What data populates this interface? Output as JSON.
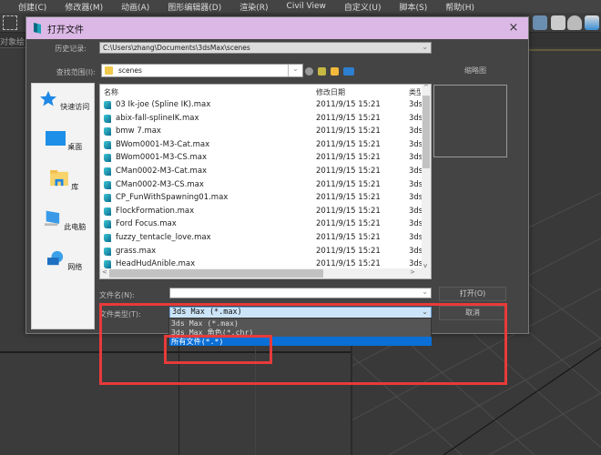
{
  "app": {
    "menu": [
      "创建(C)",
      "修改器(M)",
      "动画(A)",
      "图形编辑器(D)",
      "渲染(R)",
      "Civil View",
      "自定义(U)",
      "脚本(S)",
      "帮助(H)"
    ],
    "subbar_label": "对象绘"
  },
  "dialog": {
    "title": "打开文件",
    "close_icon": "×",
    "history_label": "历史记录:",
    "history_value": "C:\\Users\\zhang\\Documents\\3dsMax\\scenes",
    "lookin_label": "查找范围(I):",
    "lookin_value": "scenes",
    "preview_label": "缩略图",
    "places": [
      {
        "label": "快速访问",
        "icon": "star-icon"
      },
      {
        "label": "桌面",
        "icon": "desktop-icon"
      },
      {
        "label": "库",
        "icon": "library-icon"
      },
      {
        "label": "此电脑",
        "icon": "computer-icon"
      },
      {
        "label": "网络",
        "icon": "network-icon"
      }
    ],
    "columns": {
      "name": "名称",
      "date": "修改日期",
      "type": "类型"
    },
    "files": [
      {
        "name": "03 Ik-joe (Spline IK).max",
        "date": "2011/9/15 15:21",
        "type": "3ds"
      },
      {
        "name": "abix-fall-splineIK.max",
        "date": "2011/9/15 15:21",
        "type": "3ds"
      },
      {
        "name": "bmw 7.max",
        "date": "2011/9/15 15:21",
        "type": "3ds"
      },
      {
        "name": "BWom0001-M3-Cat.max",
        "date": "2011/9/15 15:21",
        "type": "3ds"
      },
      {
        "name": "BWom0001-M3-CS.max",
        "date": "2011/9/15 15:21",
        "type": "3ds"
      },
      {
        "name": "CMan0002-M3-Cat.max",
        "date": "2011/9/15 15:21",
        "type": "3ds"
      },
      {
        "name": "CMan0002-M3-CS.max",
        "date": "2011/9/15 15:21",
        "type": "3ds"
      },
      {
        "name": "CP_FunWithSpawning01.max",
        "date": "2011/9/15 15:21",
        "type": "3ds"
      },
      {
        "name": "FlockFormation.max",
        "date": "2011/9/15 15:21",
        "type": "3ds"
      },
      {
        "name": "Ford Focus.max",
        "date": "2011/9/15 15:21",
        "type": "3ds"
      },
      {
        "name": "fuzzy_tentacle_love.max",
        "date": "2011/9/15 15:21",
        "type": "3ds"
      },
      {
        "name": "grass.max",
        "date": "2011/9/15 15:21",
        "type": "3ds"
      },
      {
        "name": "HeadHudAnible.max",
        "date": "2011/9/15 15:21",
        "type": "3ds"
      }
    ],
    "filename_label": "文件名(N):",
    "filename_value": "",
    "filetype_label": "文件类型(T):",
    "filetype_value": "3ds Max (*.max)",
    "filetype_options": [
      "3ds Max (*.max)",
      "3ds Max 角色(*.chr)",
      "所有文件(*.*)"
    ],
    "filetype_selected_index": 2,
    "open_button": "打开(O)",
    "cancel_button": "取消",
    "arrow": "⌄"
  },
  "colors": {
    "annotation_red": "#e83a3a",
    "selection_blue": "#0a6fd6",
    "titlebar": "#dcb8e6"
  }
}
